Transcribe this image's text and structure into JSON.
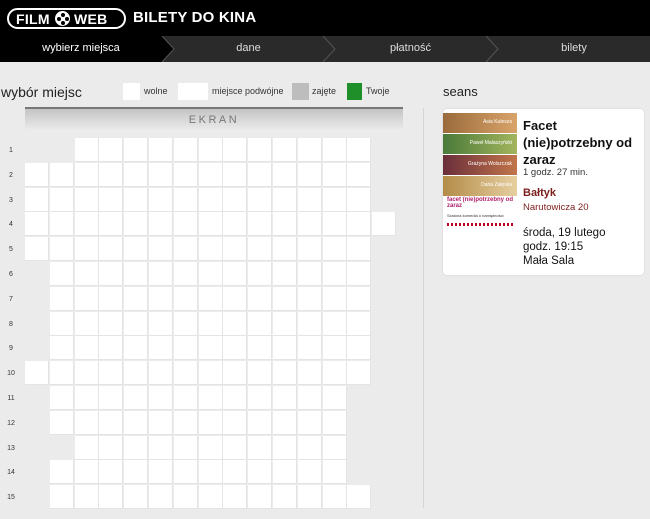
{
  "header": {
    "logo_left": "FILM",
    "logo_right": "WEB",
    "title": "BILETY DO KINA"
  },
  "steps": [
    {
      "label": "wybierz miejsca",
      "active": true
    },
    {
      "label": "dane",
      "active": false
    },
    {
      "label": "płatność",
      "active": false
    },
    {
      "label": "bilety",
      "active": false
    }
  ],
  "seat_selection": {
    "title": "wybór miejsc",
    "legend": [
      {
        "label": "wolne",
        "color": "#ffffff"
      },
      {
        "label": "miejsce podwójne",
        "color": "#ffffff"
      },
      {
        "label": "zajęte",
        "color": "#bdbdbd"
      },
      {
        "label": "Twoje",
        "color": "#1f8f2a"
      }
    ],
    "screen_label": "EKRAN",
    "rows": [
      {
        "label": "1",
        "seats": [
          0,
          0,
          1,
          1,
          1,
          1,
          1,
          1,
          1,
          1,
          1,
          1,
          1,
          1,
          0
        ]
      },
      {
        "label": "2",
        "seats": [
          1,
          1,
          1,
          1,
          1,
          1,
          1,
          1,
          1,
          1,
          1,
          1,
          1,
          1,
          0
        ]
      },
      {
        "label": "3",
        "seats": [
          1,
          1,
          1,
          1,
          1,
          1,
          1,
          1,
          1,
          1,
          1,
          1,
          1,
          1,
          0
        ]
      },
      {
        "label": "4",
        "seats": [
          1,
          1,
          1,
          1,
          1,
          1,
          1,
          1,
          1,
          1,
          1,
          1,
          1,
          1,
          1
        ]
      },
      {
        "label": "5",
        "seats": [
          1,
          1,
          1,
          1,
          1,
          1,
          1,
          1,
          1,
          1,
          1,
          1,
          1,
          1,
          0
        ]
      },
      {
        "label": "6",
        "seats": [
          0,
          1,
          1,
          1,
          1,
          1,
          1,
          1,
          1,
          1,
          1,
          1,
          1,
          1,
          0
        ]
      },
      {
        "label": "7",
        "seats": [
          0,
          1,
          1,
          1,
          1,
          1,
          1,
          1,
          1,
          1,
          1,
          1,
          1,
          1,
          0
        ]
      },
      {
        "label": "8",
        "seats": [
          0,
          1,
          1,
          1,
          1,
          1,
          1,
          1,
          1,
          1,
          1,
          1,
          1,
          1,
          0
        ]
      },
      {
        "label": "9",
        "seats": [
          0,
          1,
          1,
          1,
          1,
          1,
          1,
          1,
          1,
          1,
          1,
          1,
          1,
          1,
          0
        ]
      },
      {
        "label": "10",
        "seats": [
          1,
          1,
          1,
          1,
          1,
          1,
          1,
          1,
          1,
          1,
          1,
          1,
          1,
          1,
          0
        ]
      },
      {
        "label": "11",
        "seats": [
          0,
          1,
          1,
          1,
          1,
          1,
          1,
          1,
          1,
          1,
          1,
          1,
          1,
          0,
          0
        ]
      },
      {
        "label": "12",
        "seats": [
          0,
          1,
          1,
          1,
          1,
          1,
          1,
          1,
          1,
          1,
          1,
          1,
          1,
          0,
          0
        ]
      },
      {
        "label": "13",
        "seats": [
          0,
          0,
          1,
          1,
          1,
          1,
          1,
          1,
          1,
          1,
          1,
          1,
          1,
          0,
          0
        ]
      },
      {
        "label": "14",
        "seats": [
          0,
          1,
          1,
          1,
          1,
          1,
          1,
          1,
          1,
          1,
          1,
          1,
          1,
          0,
          0
        ]
      },
      {
        "label": "15",
        "seats": [
          0,
          1,
          1,
          1,
          1,
          1,
          1,
          1,
          1,
          1,
          1,
          1,
          1,
          1,
          0
        ]
      }
    ]
  },
  "session": {
    "title": "seans",
    "poster": {
      "line1": "facet (nie)potrzebny od zaraz",
      "line2": "Szalona komedia o namiętności",
      "actors": [
        "Asia Kulesza",
        "Paweł Małaszyński",
        "Grażyna Wolszczak",
        "Daria Załęska"
      ]
    },
    "movie_title": "Facet (nie)potrzebny od zaraz",
    "duration": "1 godz. 27 min.",
    "cinema": "Bałtyk",
    "address": "Narutowicza 20",
    "date": "środa, 19 lutego",
    "time": "godz. 19:15",
    "hall": "Mała Sala"
  }
}
